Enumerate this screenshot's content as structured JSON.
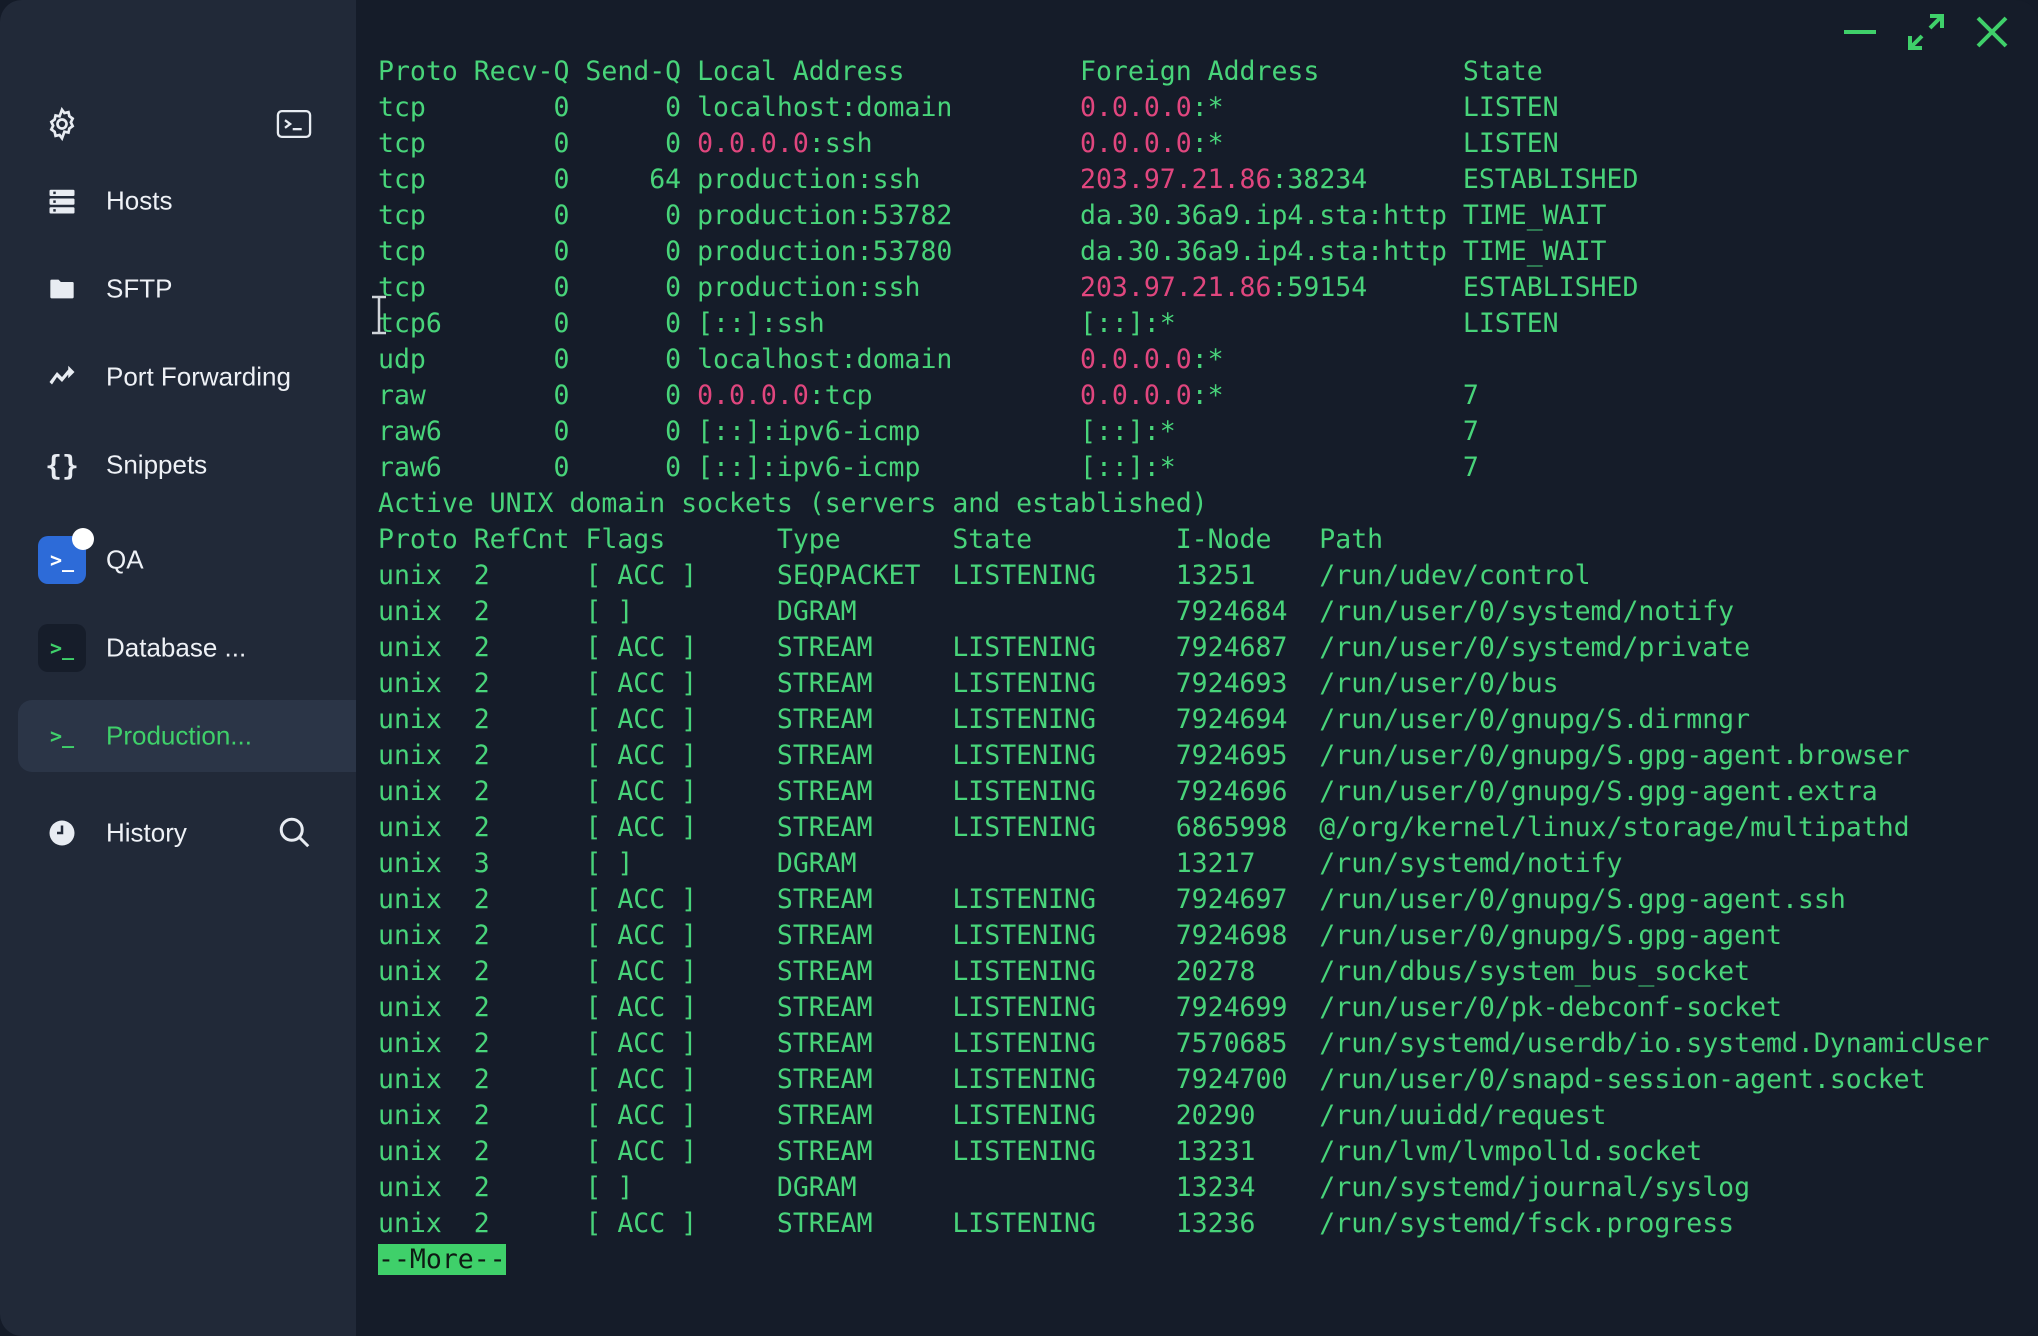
{
  "sidebar": {
    "icons": {
      "settings": "gear-icon",
      "terminal": "terminal-icon"
    },
    "items": [
      {
        "label": "Hosts",
        "icon": "hosts-icon"
      },
      {
        "label": "SFTP",
        "icon": "folder-icon"
      },
      {
        "label": "Port Forwarding",
        "icon": "port-forwarding-icon"
      },
      {
        "label": "Snippets",
        "icon": "braces-icon"
      }
    ],
    "hosts": [
      {
        "label": "QA",
        "icon_glyph": ">_"
      },
      {
        "label": "Database ...",
        "icon_glyph": ">_"
      },
      {
        "label": "Production...",
        "icon_glyph": ">_"
      }
    ],
    "history": {
      "label": "History"
    }
  },
  "colors": {
    "sidebar_bg": "#212938",
    "terminal_bg": "#151c29",
    "terminal_text": "#48d47a",
    "highlight_pink": "#e0467e",
    "active_text": "#3fd06a",
    "qa_badge": "#2d6bd8"
  },
  "terminal": {
    "lines": [
      [
        "Proto Recv-Q Send-Q Local Address           Foreign Address         State"
      ],
      [
        "tcp        0      0 localhost:domain        ",
        {
          "p": "0.0.0.0"
        },
        ":*               LISTEN"
      ],
      [
        "tcp        0      0 ",
        {
          "p": "0.0.0.0"
        },
        ":ssh             ",
        {
          "p": "0.0.0.0"
        },
        ":*               LISTEN"
      ],
      [
        "tcp        0     64 production:ssh          ",
        {
          "p": "203.97.21.86"
        },
        ":38234      ESTABLISHED"
      ],
      [
        "tcp        0      0 production:53782        da.30.36a9.ip4.sta:http TIME_WAIT"
      ],
      [
        "tcp        0      0 production:53780        da.30.36a9.ip4.sta:http TIME_WAIT"
      ],
      [
        "tcp        0      0 production:ssh          ",
        {
          "p": "203.97.21.86"
        },
        ":59154      ESTABLISHED"
      ],
      [
        "tcp6       0      0 [::]:ssh                [::]:*                  LISTEN"
      ],
      [
        "udp        0      0 localhost:domain        ",
        {
          "p": "0.0.0.0"
        },
        ":*"
      ],
      [
        "raw        0      0 ",
        {
          "p": "0.0.0.0"
        },
        ":tcp             ",
        {
          "p": "0.0.0.0"
        },
        ":*               7"
      ],
      [
        "raw6       0      0 [::]:ipv6-icmp          [::]:*                  7"
      ],
      [
        "raw6       0      0 [::]:ipv6-icmp          [::]:*                  7"
      ],
      [
        "Active UNIX domain sockets (servers and established)"
      ],
      [
        "Proto RefCnt Flags       Type       State         I-Node   Path"
      ],
      [
        "unix  2      [ ACC ]     SEQPACKET  LISTENING     13251    /run/udev/control"
      ],
      [
        "unix  2      [ ]         DGRAM                    7924684  /run/user/0/systemd/notify"
      ],
      [
        "unix  2      [ ACC ]     STREAM     LISTENING     7924687  /run/user/0/systemd/private"
      ],
      [
        "unix  2      [ ACC ]     STREAM     LISTENING     7924693  /run/user/0/bus"
      ],
      [
        "unix  2      [ ACC ]     STREAM     LISTENING     7924694  /run/user/0/gnupg/S.dirmngr"
      ],
      [
        "unix  2      [ ACC ]     STREAM     LISTENING     7924695  /run/user/0/gnupg/S.gpg-agent.browser"
      ],
      [
        "unix  2      [ ACC ]     STREAM     LISTENING     7924696  /run/user/0/gnupg/S.gpg-agent.extra"
      ],
      [
        "unix  2      [ ACC ]     STREAM     LISTENING     6865998  @/org/kernel/linux/storage/multipathd"
      ],
      [
        "unix  3      [ ]         DGRAM                    13217    /run/systemd/notify"
      ],
      [
        "unix  2      [ ACC ]     STREAM     LISTENING     7924697  /run/user/0/gnupg/S.gpg-agent.ssh"
      ],
      [
        "unix  2      [ ACC ]     STREAM     LISTENING     7924698  /run/user/0/gnupg/S.gpg-agent"
      ],
      [
        "unix  2      [ ACC ]     STREAM     LISTENING     20278    /run/dbus/system_bus_socket"
      ],
      [
        "unix  2      [ ACC ]     STREAM     LISTENING     7924699  /run/user/0/pk-debconf-socket"
      ],
      [
        "unix  2      [ ACC ]     STREAM     LISTENING     7570685  /run/systemd/userdb/io.systemd.DynamicUser"
      ],
      [
        "unix  2      [ ACC ]     STREAM     LISTENING     7924700  /run/user/0/snapd-session-agent.socket"
      ],
      [
        "unix  2      [ ACC ]     STREAM     LISTENING     20290    /run/uuidd/request"
      ],
      [
        "unix  2      [ ACC ]     STREAM     LISTENING     13231    /run/lvm/lvmpolld.socket"
      ],
      [
        "unix  2      [ ]         DGRAM                    13234    /run/systemd/journal/syslog"
      ],
      [
        "unix  2      [ ACC ]     STREAM     LISTENING     13236    /run/systemd/fsck.progress"
      ]
    ],
    "more_prompt": "--More--"
  },
  "window_controls": [
    "minimize-icon",
    "maximize-icon",
    "close-icon"
  ]
}
